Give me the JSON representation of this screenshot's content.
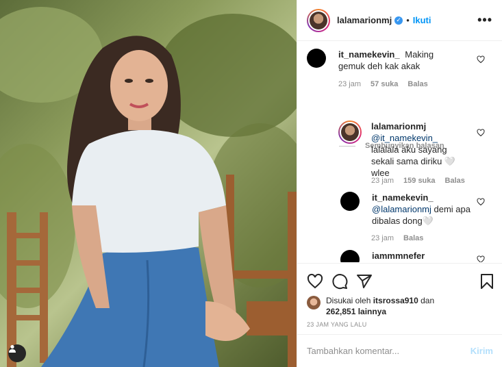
{
  "header": {
    "username": "lalamarionmj",
    "verified_icon": "verified-check-icon",
    "separator": "•",
    "follow_label": "Ikuti",
    "more_label": "•••"
  },
  "comments": [
    {
      "username": "it_namekevin_",
      "text": "Making gemuk deh kak akak",
      "time": "23 jam",
      "likes": "57 suka",
      "reply_label": "Balas"
    }
  ],
  "hide_replies_label": "Sembunyikan balasan",
  "replies": [
    {
      "username": "lalamarionmj",
      "mention": "@it_namekevin_",
      "text": "lalalala aku sayang sekali sama diriku 🤍 wlee",
      "time": "23 jam",
      "likes": "159 suka",
      "reply_label": "Balas"
    },
    {
      "username": "it_namekevin_",
      "mention": "@lalamarionmj",
      "text": "demi apa dibalas dong🤍",
      "time": "23 jam",
      "reply_label": "Balas"
    },
    {
      "username": "iammmnefer"
    }
  ],
  "likes": {
    "prefix": "Disukai oleh",
    "user": "itsrossa910",
    "joiner": "dan",
    "count": "262,851 lainnya"
  },
  "timeago": "23 JAM YANG LALU",
  "add_comment": {
    "placeholder": "Tambahkan komentar...",
    "post_label": "Kirim"
  },
  "colors": {
    "accent": "#0095f6",
    "post_disabled": "#b2dffc",
    "muted": "#8e8e8e"
  }
}
